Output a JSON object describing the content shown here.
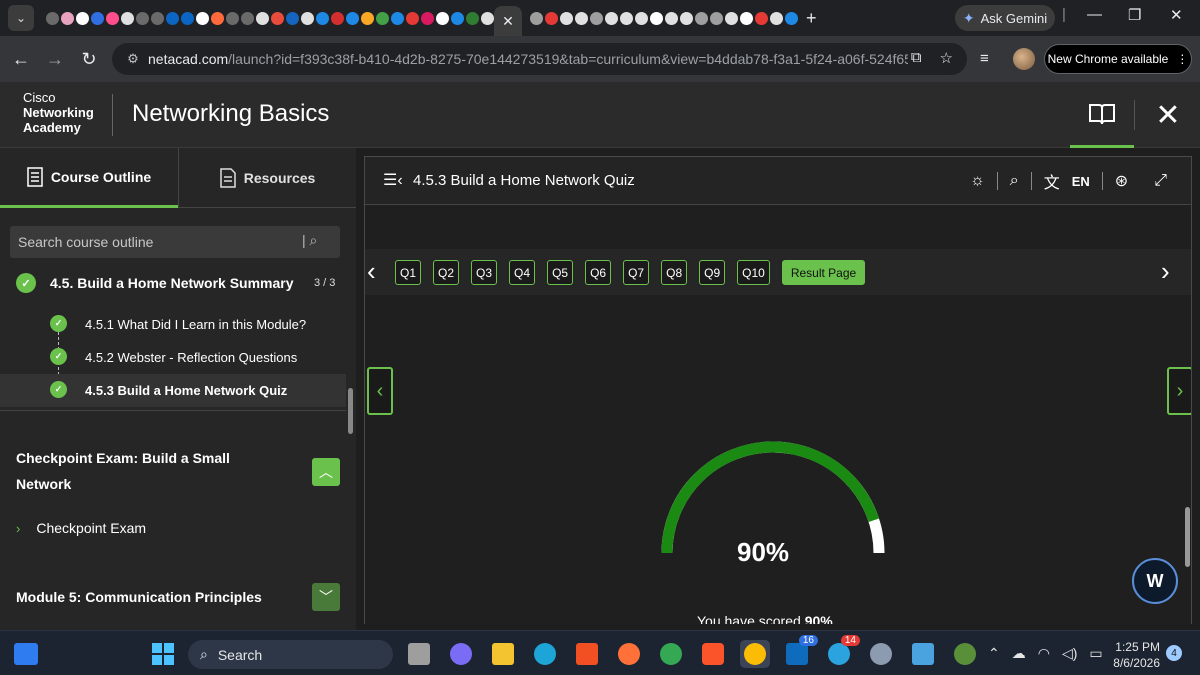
{
  "browser": {
    "url_host": "netacad.com",
    "url_path": "/launch?id=f393c38f-b410-4d2b-8275-70e144273519&tab=curriculum&view=b4ddab78-f3a1-5f24-a06f-524f653...",
    "active_tab_close": "✕",
    "ask_gemini": "Ask Gemini",
    "new_chrome": "New Chrome available"
  },
  "header": {
    "logo_line1": "Cisco",
    "logo_line2": "Networking",
    "logo_line3": "Academy",
    "course_title": "Networking Basics"
  },
  "sidebar": {
    "tab_outline": "Course Outline",
    "tab_resources": "Resources",
    "search_placeholder": "Search course outline",
    "section": {
      "title": "4.5. Build a Home Network Summary",
      "count": "3 / 3",
      "items": [
        {
          "label": "4.5.1 What Did I Learn in this Module?"
        },
        {
          "label": "4.5.2 Webster - Reflection Questions"
        },
        {
          "label": "4.5.3 Build a Home Network Quiz"
        }
      ]
    },
    "checkpoint": {
      "title_line1": "Checkpoint Exam: Build a Small",
      "title_line2": "Network",
      "link": "Checkpoint Exam"
    },
    "module5": "Module 5: Communication Principles"
  },
  "content": {
    "title": "4.5.3 Build a Home Network Quiz",
    "language": "EN",
    "questions": [
      "Q1",
      "Q2",
      "Q3",
      "Q4",
      "Q5",
      "Q6",
      "Q7",
      "Q8",
      "Q9",
      "Q10"
    ],
    "result_label": "Result Page",
    "score_fraction": 0.9,
    "score_text": "90%",
    "scored_prefix": "You have scored",
    "scored_value": "90%"
  },
  "taskbar": {
    "search_label": "Search",
    "badge_a": "16",
    "badge_b": "14",
    "time": "1:25 PM",
    "date": "8/6/2026",
    "notifications": "4"
  },
  "colors": {
    "accent_green": "#6ac14c",
    "gauge_green": "#1a8a12"
  }
}
